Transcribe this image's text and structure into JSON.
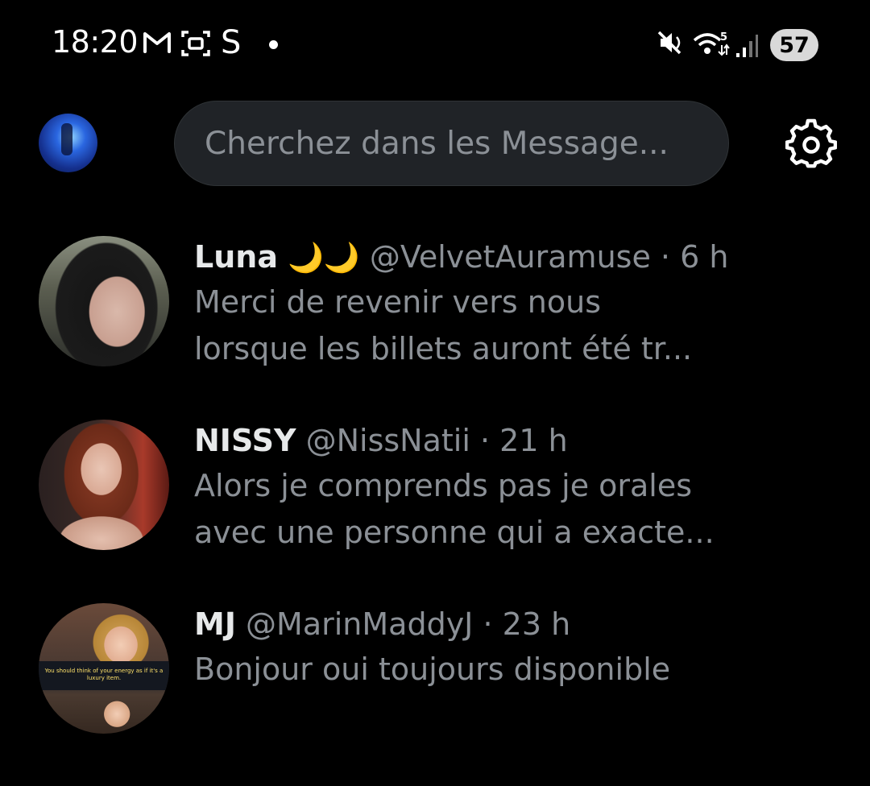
{
  "status_bar": {
    "time": "18:20",
    "icons": [
      "gmail-icon",
      "screenshot-icon",
      "s-icon",
      "dot-icon",
      "mute-icon",
      "wifi-icon",
      "signal-icon"
    ],
    "s_label": "S",
    "battery": "57"
  },
  "header": {
    "search_placeholder": "Cherchez dans les Message..."
  },
  "conversations": [
    {
      "name": "Luna",
      "emoji": "🌙🌙",
      "handle": "@VelvetAuramuse",
      "separator": " · ",
      "time": "6 h",
      "message_line1": "Merci de revenir vers nous",
      "message_line2": "lorsque les billets auront été tr..."
    },
    {
      "name": "NISSY",
      "handle": "@NissNatii",
      "separator": " · ",
      "time": "21 h",
      "message_line1": "Alors je comprends pas je orales",
      "message_line2": "avec une personne qui a exacte..."
    },
    {
      "name": "MJ",
      "handle": "@MarinMaddyJ",
      "separator": " · ",
      "time": "23 h",
      "message_line1": "Bonjour oui toujours disponible",
      "avatar_caption": "You should think of your energy as if it's a luxury item."
    }
  ],
  "colors": {
    "background": "#000000",
    "primary_text": "#e7e9ea",
    "secondary_text": "#8b9096",
    "search_bg": "#202327"
  }
}
